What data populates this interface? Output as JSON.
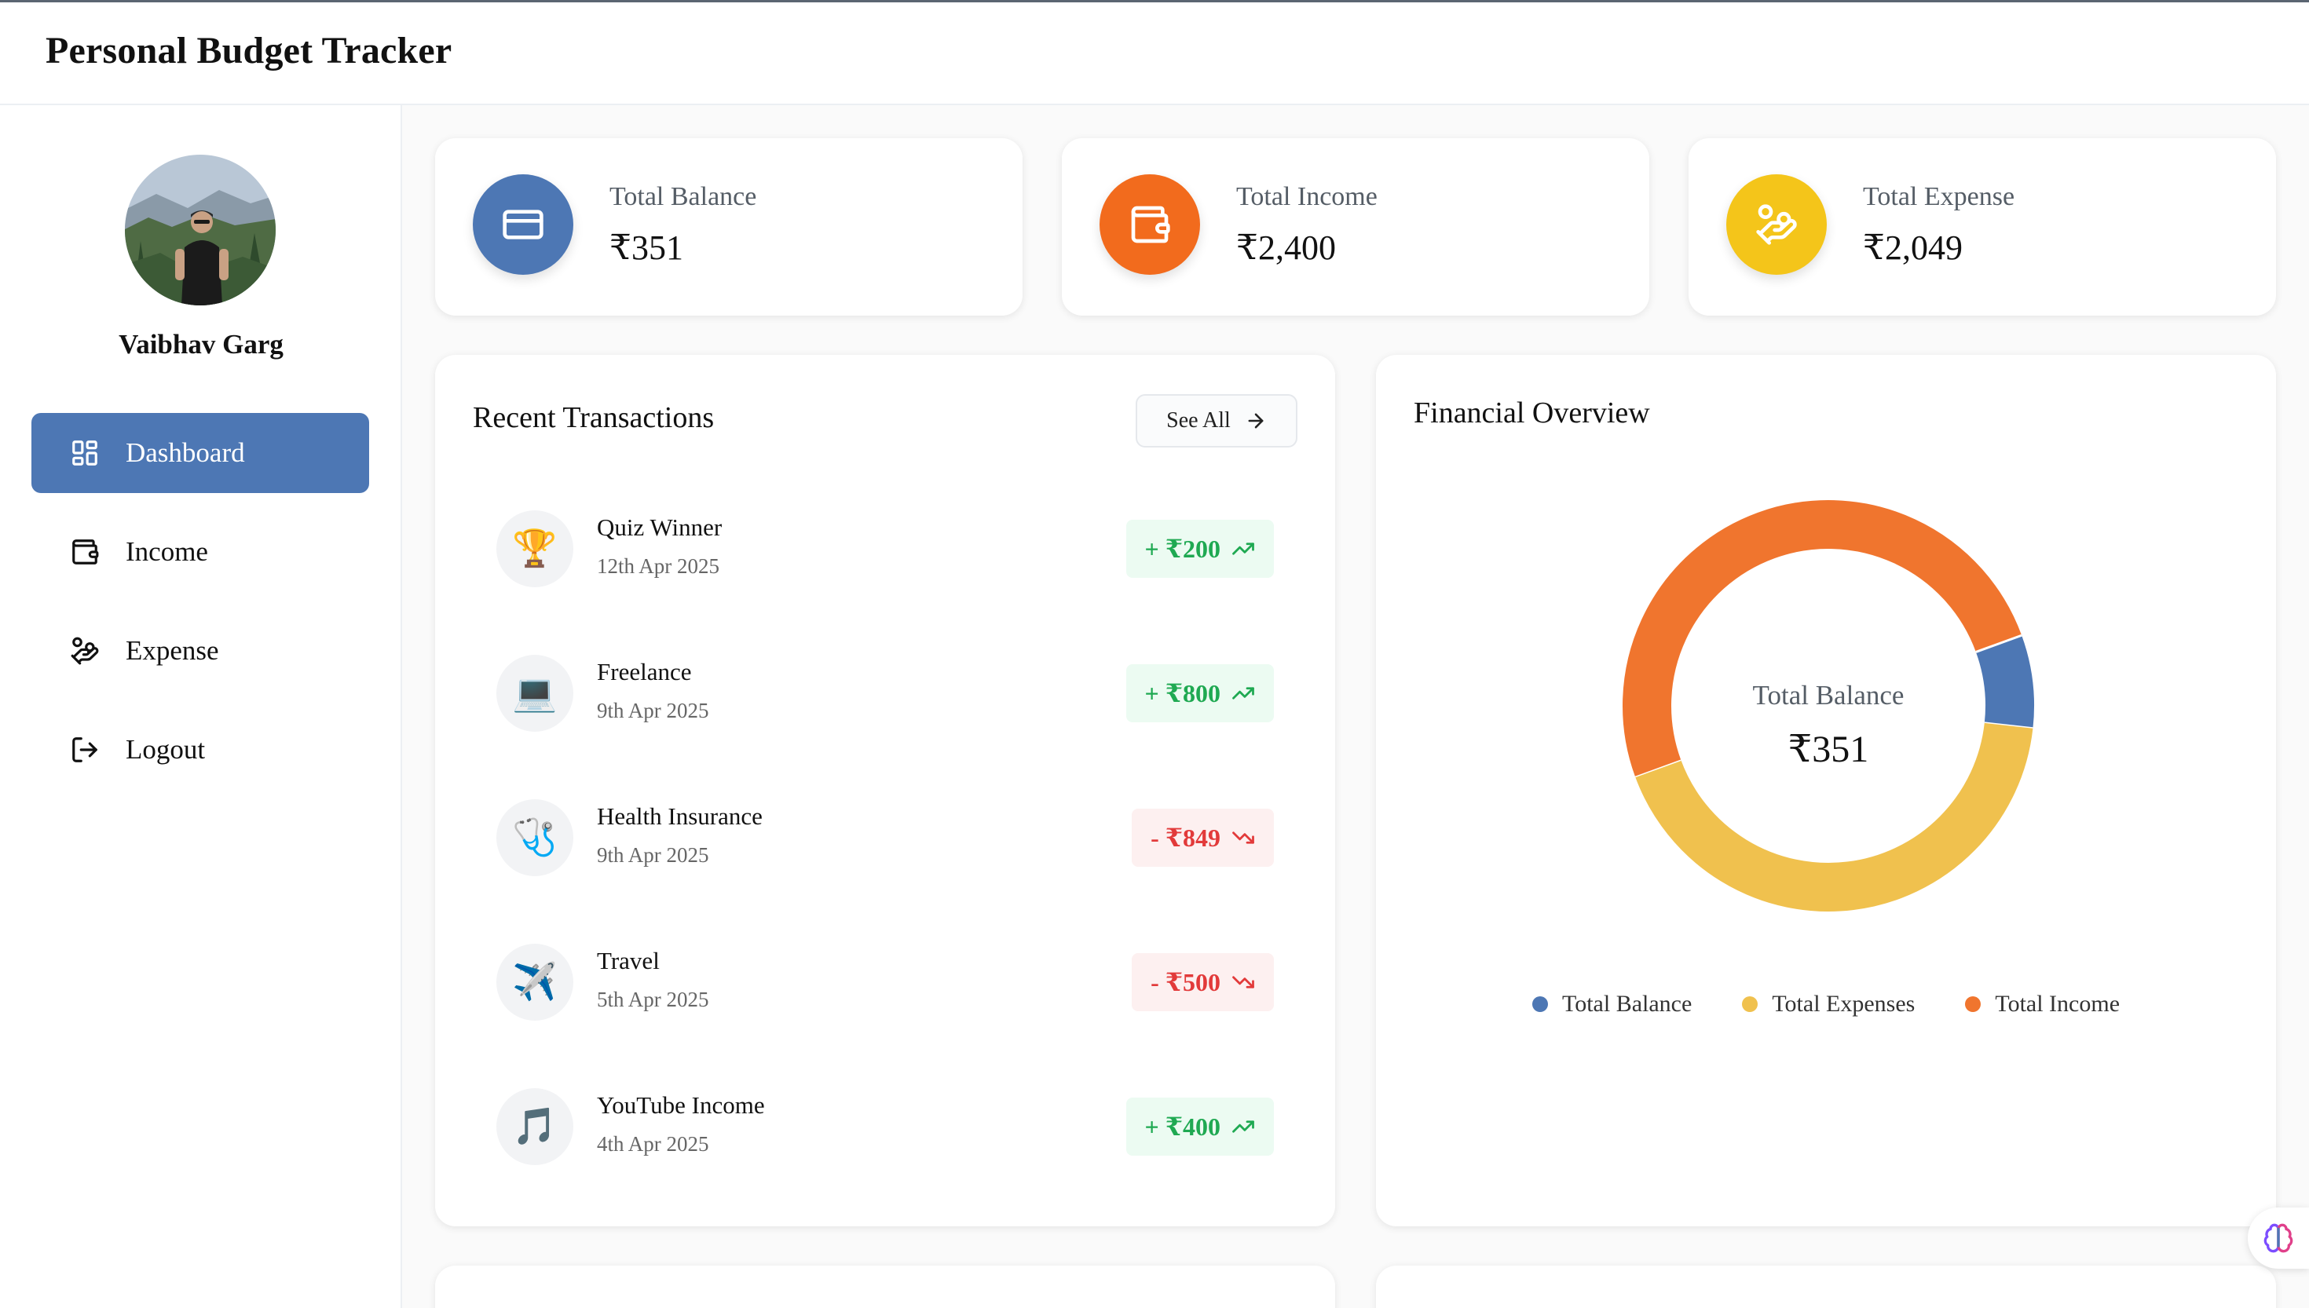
{
  "app": {
    "title": "Personal Budget Tracker"
  },
  "user": {
    "name": "Vaibhav Garg"
  },
  "sidebar": {
    "items": [
      {
        "label": "Dashboard",
        "icon": "dashboard-icon",
        "active": true
      },
      {
        "label": "Income",
        "icon": "wallet-icon",
        "active": false
      },
      {
        "label": "Expense",
        "icon": "hand-coins-icon",
        "active": false
      },
      {
        "label": "Logout",
        "icon": "logout-icon",
        "active": false
      }
    ]
  },
  "stats": [
    {
      "label": "Total Balance",
      "value": "₹351",
      "icon": "card-icon",
      "color": "#4d77b4"
    },
    {
      "label": "Total Income",
      "value": "₹2,400",
      "icon": "wallet-icon",
      "color": "#f26b1d"
    },
    {
      "label": "Total Expense",
      "value": "₹2,049",
      "icon": "hand-coins-icon",
      "color": "#f4c51a"
    }
  ],
  "recent": {
    "title": "Recent Transactions",
    "see_all": "See All",
    "items": [
      {
        "name": "Quiz Winner",
        "date": "12th Apr 2025",
        "amount": "+ ₹200",
        "type": "income",
        "emoji": "🏆"
      },
      {
        "name": "Freelance",
        "date": "9th Apr 2025",
        "amount": "+ ₹800",
        "type": "income",
        "emoji": "💻"
      },
      {
        "name": "Health Insurance",
        "date": "9th Apr 2025",
        "amount": "- ₹849",
        "type": "expense",
        "emoji": "🩺"
      },
      {
        "name": "Travel",
        "date": "5th Apr 2025",
        "amount": "- ₹500",
        "type": "expense",
        "emoji": "✈️"
      },
      {
        "name": "YouTube Income",
        "date": "4th Apr 2025",
        "amount": "+ ₹400",
        "type": "income",
        "emoji": "🎵"
      }
    ]
  },
  "overview": {
    "title": "Financial Overview",
    "center_label": "Total Balance",
    "center_value": "₹351"
  },
  "chart_data": {
    "type": "pie",
    "categories": [
      "Total Balance",
      "Total Expenses",
      "Total Income"
    ],
    "values": [
      351,
      2049,
      2400
    ],
    "colors": [
      "#4d77b4",
      "#f0c14e",
      "#f0752e"
    ],
    "legend": "bottom"
  }
}
